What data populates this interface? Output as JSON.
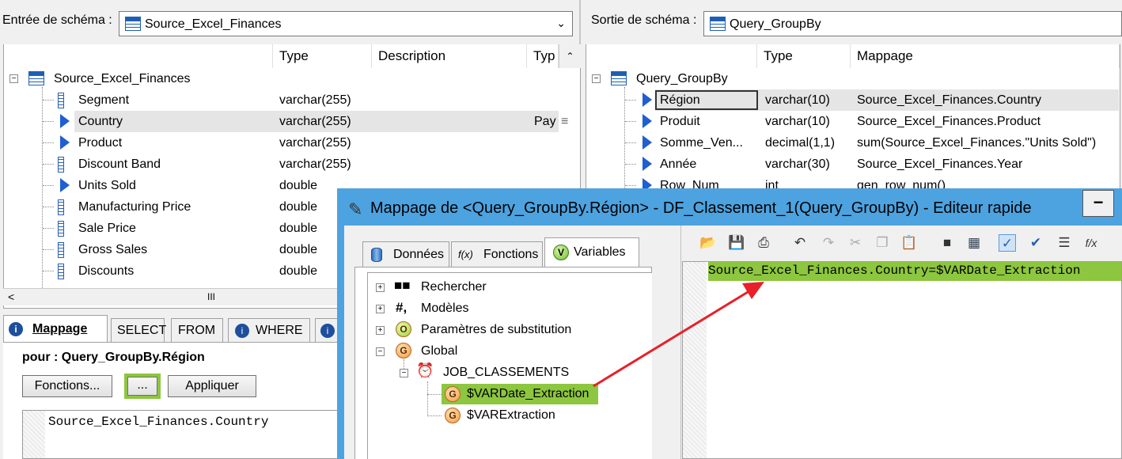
{
  "left": {
    "schema_input_label": "Entrée de schéma :",
    "schema_input_value": "Source_Excel_Finances",
    "columns": {
      "name": "",
      "type": "Type",
      "description": "Description",
      "type2": "Typ"
    },
    "root": "Source_Excel_Finances",
    "rows": [
      {
        "name": "Segment",
        "type": "varchar(255)",
        "desc": "",
        "icon": "column-icon"
      },
      {
        "name": "Country",
        "type": "varchar(255)",
        "desc": "",
        "extra": "Pay",
        "icon": "arrow-icon"
      },
      {
        "name": "Product",
        "type": "varchar(255)",
        "desc": "",
        "icon": "arrow-icon"
      },
      {
        "name": "Discount Band",
        "type": "varchar(255)",
        "desc": "",
        "icon": "column-icon"
      },
      {
        "name": "Units Sold",
        "type": "double",
        "desc": "",
        "icon": "arrow-icon"
      },
      {
        "name": "Manufacturing Price",
        "type": "double",
        "desc": "",
        "icon": "column-icon"
      },
      {
        "name": "Sale Price",
        "type": "double",
        "desc": "",
        "icon": "column-icon"
      },
      {
        "name": "Gross Sales",
        "type": "double",
        "desc": "",
        "icon": "column-icon"
      },
      {
        "name": "Discounts",
        "type": "double",
        "desc": "",
        "icon": "column-icon"
      }
    ],
    "scroll_mid": "III"
  },
  "right": {
    "schema_output_label": "Sortie de schéma :",
    "schema_output_value": "Query_GroupBy",
    "columns": {
      "type": "Type",
      "mapping": "Mappage"
    },
    "root": "Query_GroupBy",
    "rows": [
      {
        "name": "Région",
        "type": "varchar(10)",
        "mapping": "Source_Excel_Finances.Country"
      },
      {
        "name": "Produit",
        "type": "varchar(10)",
        "mapping": "Source_Excel_Finances.Product"
      },
      {
        "name": "Somme_Ven...",
        "type": "decimal(1,1)",
        "mapping": "sum(Source_Excel_Finances.\"Units Sold\")"
      },
      {
        "name": "Année",
        "type": "varchar(30)",
        "mapping": "Source_Excel_Finances.Year"
      },
      {
        "name": "Row_Num",
        "type": "int",
        "mapping": "gen_row_num()"
      }
    ]
  },
  "bottom": {
    "tabs": [
      "Mappage",
      "SELECT",
      "FROM",
      "WHERE"
    ],
    "pour_label": "pour : Query_GroupBy.Région",
    "buttons": {
      "fonctions": "Fonctions...",
      "dots": "...",
      "appliquer": "Appliquer"
    },
    "editor_text": "Source_Excel_Finances.Country"
  },
  "dialog": {
    "title": "Mappage de <Query_GroupBy.Région> - DF_Classement_1(Query_GroupBy) - Editeur rapide",
    "minimize": "−",
    "tabs": {
      "donnees": "Données",
      "fonctions": "Fonctions",
      "variables": "Variables"
    },
    "tab_icon_letters": {
      "fonctions": "f(x)",
      "variables": "V"
    },
    "tree": {
      "rechercher": "Rechercher",
      "modeles": "Modèles",
      "modeles_icon": "#,",
      "parametres": "Paramètres de substitution",
      "global": "Global",
      "job": "JOB_CLASSEMENTS",
      "var1": "$VARDate_Extraction",
      "var2": "$VARExtraction",
      "icon_letters": {
        "parametres": "O",
        "global": "G",
        "var": "G"
      }
    },
    "editor_text": "Source_Excel_Finances.Country=$VARDate_Extraction",
    "toolbar_fx": "f/x"
  },
  "colors": {
    "highlight_green": "#8dc63f",
    "dialog_blue": "#4da3e0",
    "arrow_red": "#e8202a",
    "selected_row": "#e5e5e5"
  }
}
